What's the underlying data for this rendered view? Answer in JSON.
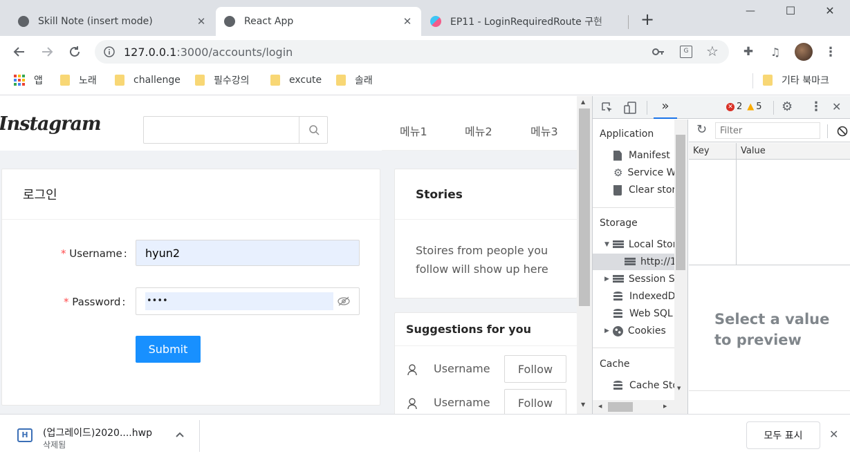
{
  "tabs": [
    {
      "title": "Skill Note (insert mode)",
      "close": "✕"
    },
    {
      "title": "React App",
      "close": "✕"
    },
    {
      "title": "EP11 - LoginRequiredRoute 구현",
      "close": "✕"
    }
  ],
  "new_tab": "+",
  "window_controls": {
    "minimize": "—",
    "maximize": "☐",
    "close": "✕"
  },
  "address": {
    "host": "127.0.0.1",
    "rest": ":3000/accounts/login"
  },
  "bookmarks": {
    "apps": "앱",
    "items": [
      "노래",
      "challenge",
      "필수강의",
      "excute",
      "솔래"
    ],
    "other": "기타 북마크"
  },
  "header": {
    "logo": "Instagram",
    "search_placeholder": "",
    "menu": [
      "메뉴1",
      "메뉴2",
      "메뉴3"
    ]
  },
  "login": {
    "title": "로그인",
    "username_label": "Username",
    "username_value": "hyun2",
    "password_label": "Password",
    "password_value": "••••",
    "required_mark": "*",
    "colon": ":",
    "submit": "Submit"
  },
  "stories": {
    "title": "Stories",
    "body": "Stoires from people you follow will show up here"
  },
  "suggestions": {
    "title": "Suggestions for you",
    "items": [
      {
        "username": "Username",
        "action": "Follow"
      },
      {
        "username": "Username",
        "action": "Follow"
      }
    ]
  },
  "devtools": {
    "more_tabs": "»",
    "errors": "2",
    "warnings": "5",
    "sections": {
      "application": "Application",
      "manifest": "Manifest",
      "service_workers": "Service W",
      "clear_storage": "Clear stor",
      "storage": "Storage",
      "local_storage": "Local Stor",
      "local_origin": "http://1",
      "session_storage": "Session S",
      "indexeddb": "IndexedD",
      "websql": "Web SQL",
      "cookies": "Cookies",
      "cache": "Cache",
      "cache_storage": "Cache Sto"
    },
    "filter_placeholder": "Filter",
    "table": {
      "key_header": "Key",
      "value_header": "Value"
    },
    "preview": "Select a value to preview"
  },
  "download": {
    "filename": "(업그레이드)2020....hwp",
    "status": "삭제됨",
    "show_all": "모두 표시"
  },
  "colors": {
    "primary": "#1890ff",
    "required": "#ff4d4f",
    "autofill": "#e8f0fe",
    "tabstrip": "#dee1e6",
    "devtools_accent": "#1a73e8"
  }
}
